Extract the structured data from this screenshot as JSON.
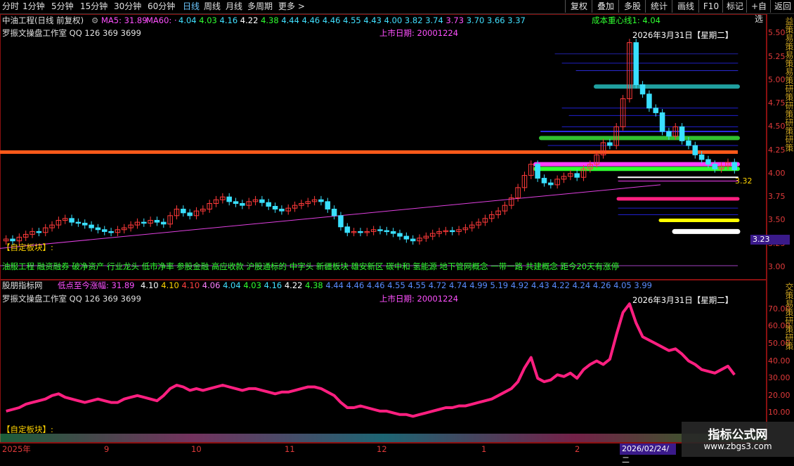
{
  "toolbar": {
    "periods": [
      "分时",
      "1分钟",
      "5分钟",
      "15分钟",
      "30分钟",
      "60分钟",
      "日线",
      "周线",
      "月线",
      "多周期",
      "更多 >"
    ],
    "active_period": "日线",
    "right_buttons": [
      "复权",
      "叠加",
      "多股",
      "统计",
      "画线",
      "F10",
      "标记",
      "+自选",
      "返回"
    ]
  },
  "main_header": {
    "stock": "中油工程(日线 前复权)",
    "ma5_label": "MA5: 31.89",
    "ma60_label": "MA60: ·",
    "ma_values": [
      "4.04",
      "4.03",
      "4.16",
      "4.22",
      "4.38",
      "4.44",
      "4.46",
      "4.46",
      "4.55",
      "4.43",
      "4.00",
      "3.82",
      "3.74",
      "3.73",
      "3.70",
      "3.66",
      "3.37"
    ],
    "cost_line": "成本重心线1: 4.04"
  },
  "main_panel": {
    "studio": "罗振文操盘工作室 QQ 126 369 3699",
    "list_date": "上市日期: 20001224",
    "date_label": "2026年3月31日【星期二】",
    "custom_block": "【自定板块】:",
    "concepts": "油服工程 融资融券 破净资产 行业龙头 低市净率 参股金融 高应收款 沪股通标的 中字头 新疆板块 雄安新区 碳中和 氢能源 地下管网概念 一带一路 共建概念 距今20天有涨停",
    "price_tag": "3.32",
    "low_tag": "3.23",
    "y_ticks": [
      "5.50",
      "5.25",
      "5.00",
      "4.75",
      "4.50",
      "4.25",
      "4.00",
      "3.75",
      "3.50",
      "3.25",
      "3.00"
    ]
  },
  "sub_header": {
    "title": "股朋指标网",
    "label": "低点至今涨幅: 31.89",
    "values": [
      "4.10",
      "4.10",
      "4.10",
      "4.06",
      "4.04",
      "4.03",
      "4.16",
      "4.22",
      "4.38",
      "4.44",
      "4.46",
      "4.46",
      "4.55",
      "4.55",
      "4.72",
      "4.74",
      "4.99",
      "5.19",
      "4.92",
      "4.43",
      "4.22",
      "4.24",
      "4.26",
      "4.05",
      "3.99"
    ]
  },
  "sub_panel": {
    "studio": "罗振文操盘工作室 QQ 126 369 3699",
    "list_date": "上市日期: 20001224",
    "date_label": "2026年3月31日【星期二】",
    "custom_block": "【自定板块】:",
    "y_ticks": [
      "70.00",
      "60.00",
      "50.00",
      "40.00",
      "30.00",
      "20.00",
      "10.00"
    ]
  },
  "x_axis": {
    "labels": [
      "2025年",
      "9",
      "10",
      "11",
      "12",
      "1",
      "2"
    ],
    "cursor_date": "2026/02/24/二"
  },
  "watermark": {
    "title": "指标公式网",
    "url": "www.zbgs3.com"
  },
  "colors": {
    "up": "#ff3a3a",
    "down": "#3ae0ff",
    "ma": "#ff40ff",
    "cost": "#30ff30",
    "sub_line": "#ff1f80"
  },
  "chart_data": {
    "type": "line",
    "title": "",
    "price_ylim": [
      3.0,
      5.6
    ],
    "sub_ylim": [
      0,
      78
    ],
    "closes": [
      3.3,
      3.28,
      3.32,
      3.35,
      3.38,
      3.37,
      3.42,
      3.45,
      3.5,
      3.52,
      3.48,
      3.47,
      3.45,
      3.42,
      3.4,
      3.38,
      3.37,
      3.4,
      3.42,
      3.45,
      3.48,
      3.47,
      3.5,
      3.48,
      3.46,
      3.55,
      3.62,
      3.58,
      3.55,
      3.6,
      3.62,
      3.68,
      3.72,
      3.75,
      3.7,
      3.68,
      3.66,
      3.7,
      3.72,
      3.69,
      3.65,
      3.62,
      3.6,
      3.63,
      3.66,
      3.68,
      3.7,
      3.72,
      3.7,
      3.62,
      3.55,
      3.43,
      3.37,
      3.38,
      3.37,
      3.38,
      3.4,
      3.39,
      3.38,
      3.36,
      3.33,
      3.3,
      3.28,
      3.31,
      3.33,
      3.36,
      3.38,
      3.39,
      3.38,
      3.4,
      3.42,
      3.45,
      3.48,
      3.52,
      3.56,
      3.6,
      3.66,
      3.74,
      3.85,
      3.98,
      4.1,
      3.95,
      3.9,
      3.88,
      3.94,
      3.97,
      4.0,
      3.96,
      4.05,
      4.1,
      4.2,
      4.33,
      4.3,
      4.5,
      4.8,
      5.4,
      4.95,
      4.85,
      4.7,
      4.65,
      4.45,
      4.4,
      4.5,
      4.35,
      4.3,
      4.2,
      4.15,
      4.1,
      4.05,
      4.08,
      4.12,
      4.04
    ],
    "sub_values": [
      11,
      12,
      13,
      15,
      16,
      17,
      18,
      20,
      21,
      19,
      18,
      17,
      16,
      17,
      18,
      17,
      16,
      16,
      18,
      19,
      20,
      19,
      18,
      17,
      20,
      24,
      26,
      25,
      23,
      24,
      23,
      24,
      25,
      26,
      25,
      24,
      23,
      24,
      24,
      23,
      22,
      21,
      22,
      22,
      23,
      24,
      25,
      25,
      24,
      22,
      20,
      16,
      13,
      13,
      14,
      13,
      12,
      11,
      11,
      10,
      9,
      9,
      8,
      9,
      10,
      11,
      12,
      13,
      13,
      14,
      14,
      15,
      16,
      17,
      18,
      20,
      22,
      24,
      28,
      36,
      42,
      30,
      28,
      29,
      32,
      31,
      33,
      30,
      35,
      38,
      40,
      38,
      41,
      55,
      68,
      73,
      62,
      54,
      52,
      50,
      48,
      46,
      47,
      44,
      40,
      38,
      35,
      34,
      33,
      35,
      37,
      32
    ]
  }
}
